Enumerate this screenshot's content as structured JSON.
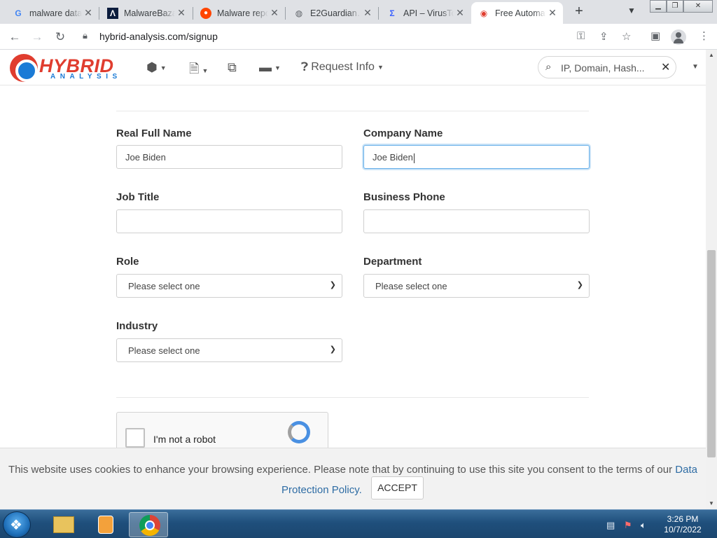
{
  "tabs": [
    {
      "title": "malware data…",
      "favicon": "google-icon",
      "favicon_color": "#4285f4",
      "active": false
    },
    {
      "title": "MalwareBazaar",
      "favicon": "malwarebazaar-icon",
      "favicon_color": "#0b1c3d",
      "active": false
    },
    {
      "title": "Malware repo…",
      "favicon": "reddit-icon",
      "favicon_color": "#ff4500",
      "active": false
    },
    {
      "title": "E2Guardian…",
      "favicon": "globe-icon",
      "favicon_color": "#5f6368",
      "active": false
    },
    {
      "title": "API – VirusTotal",
      "favicon": "virustotal-icon",
      "favicon_color": "#3b61ff",
      "active": false
    },
    {
      "title": "Free Automated…",
      "favicon": "hybrid-analysis-icon",
      "favicon_color": "#e03d2f",
      "active": true
    }
  ],
  "browser": {
    "url": "hybrid-analysis.com/signup"
  },
  "site": {
    "logo_top": "HYBRID",
    "logo_bottom": "ANALYSIS",
    "nav_request_info": "Request Info",
    "search_placeholder": "IP, Domain, Hash..."
  },
  "form": {
    "full_name_label": "Real Full Name",
    "full_name_value": "Joe Biden",
    "company_label": "Company Name",
    "company_value": "Joe Biden",
    "job_title_label": "Job Title",
    "job_title_value": "",
    "phone_label": "Business Phone",
    "phone_value": "",
    "role_label": "Role",
    "role_value": "Please select one",
    "department_label": "Department",
    "department_value": "Please select one",
    "industry_label": "Industry",
    "industry_value": "Please select one",
    "captcha_label": "I'm not a robot"
  },
  "cookie": {
    "text": "This website uses cookies to enhance your browsing experience. Please note that by continuing to use this site you consent to the terms of our ",
    "link_part1": "Data",
    "link_part2": "Protection Policy.",
    "accept": "ACCEPT"
  },
  "taskbar": {
    "time": "3:26 PM",
    "date": "10/7/2022"
  },
  "colors": {
    "accent_red": "#e03d2f",
    "accent_blue": "#1b7bd6",
    "link": "#2e6ca4"
  }
}
